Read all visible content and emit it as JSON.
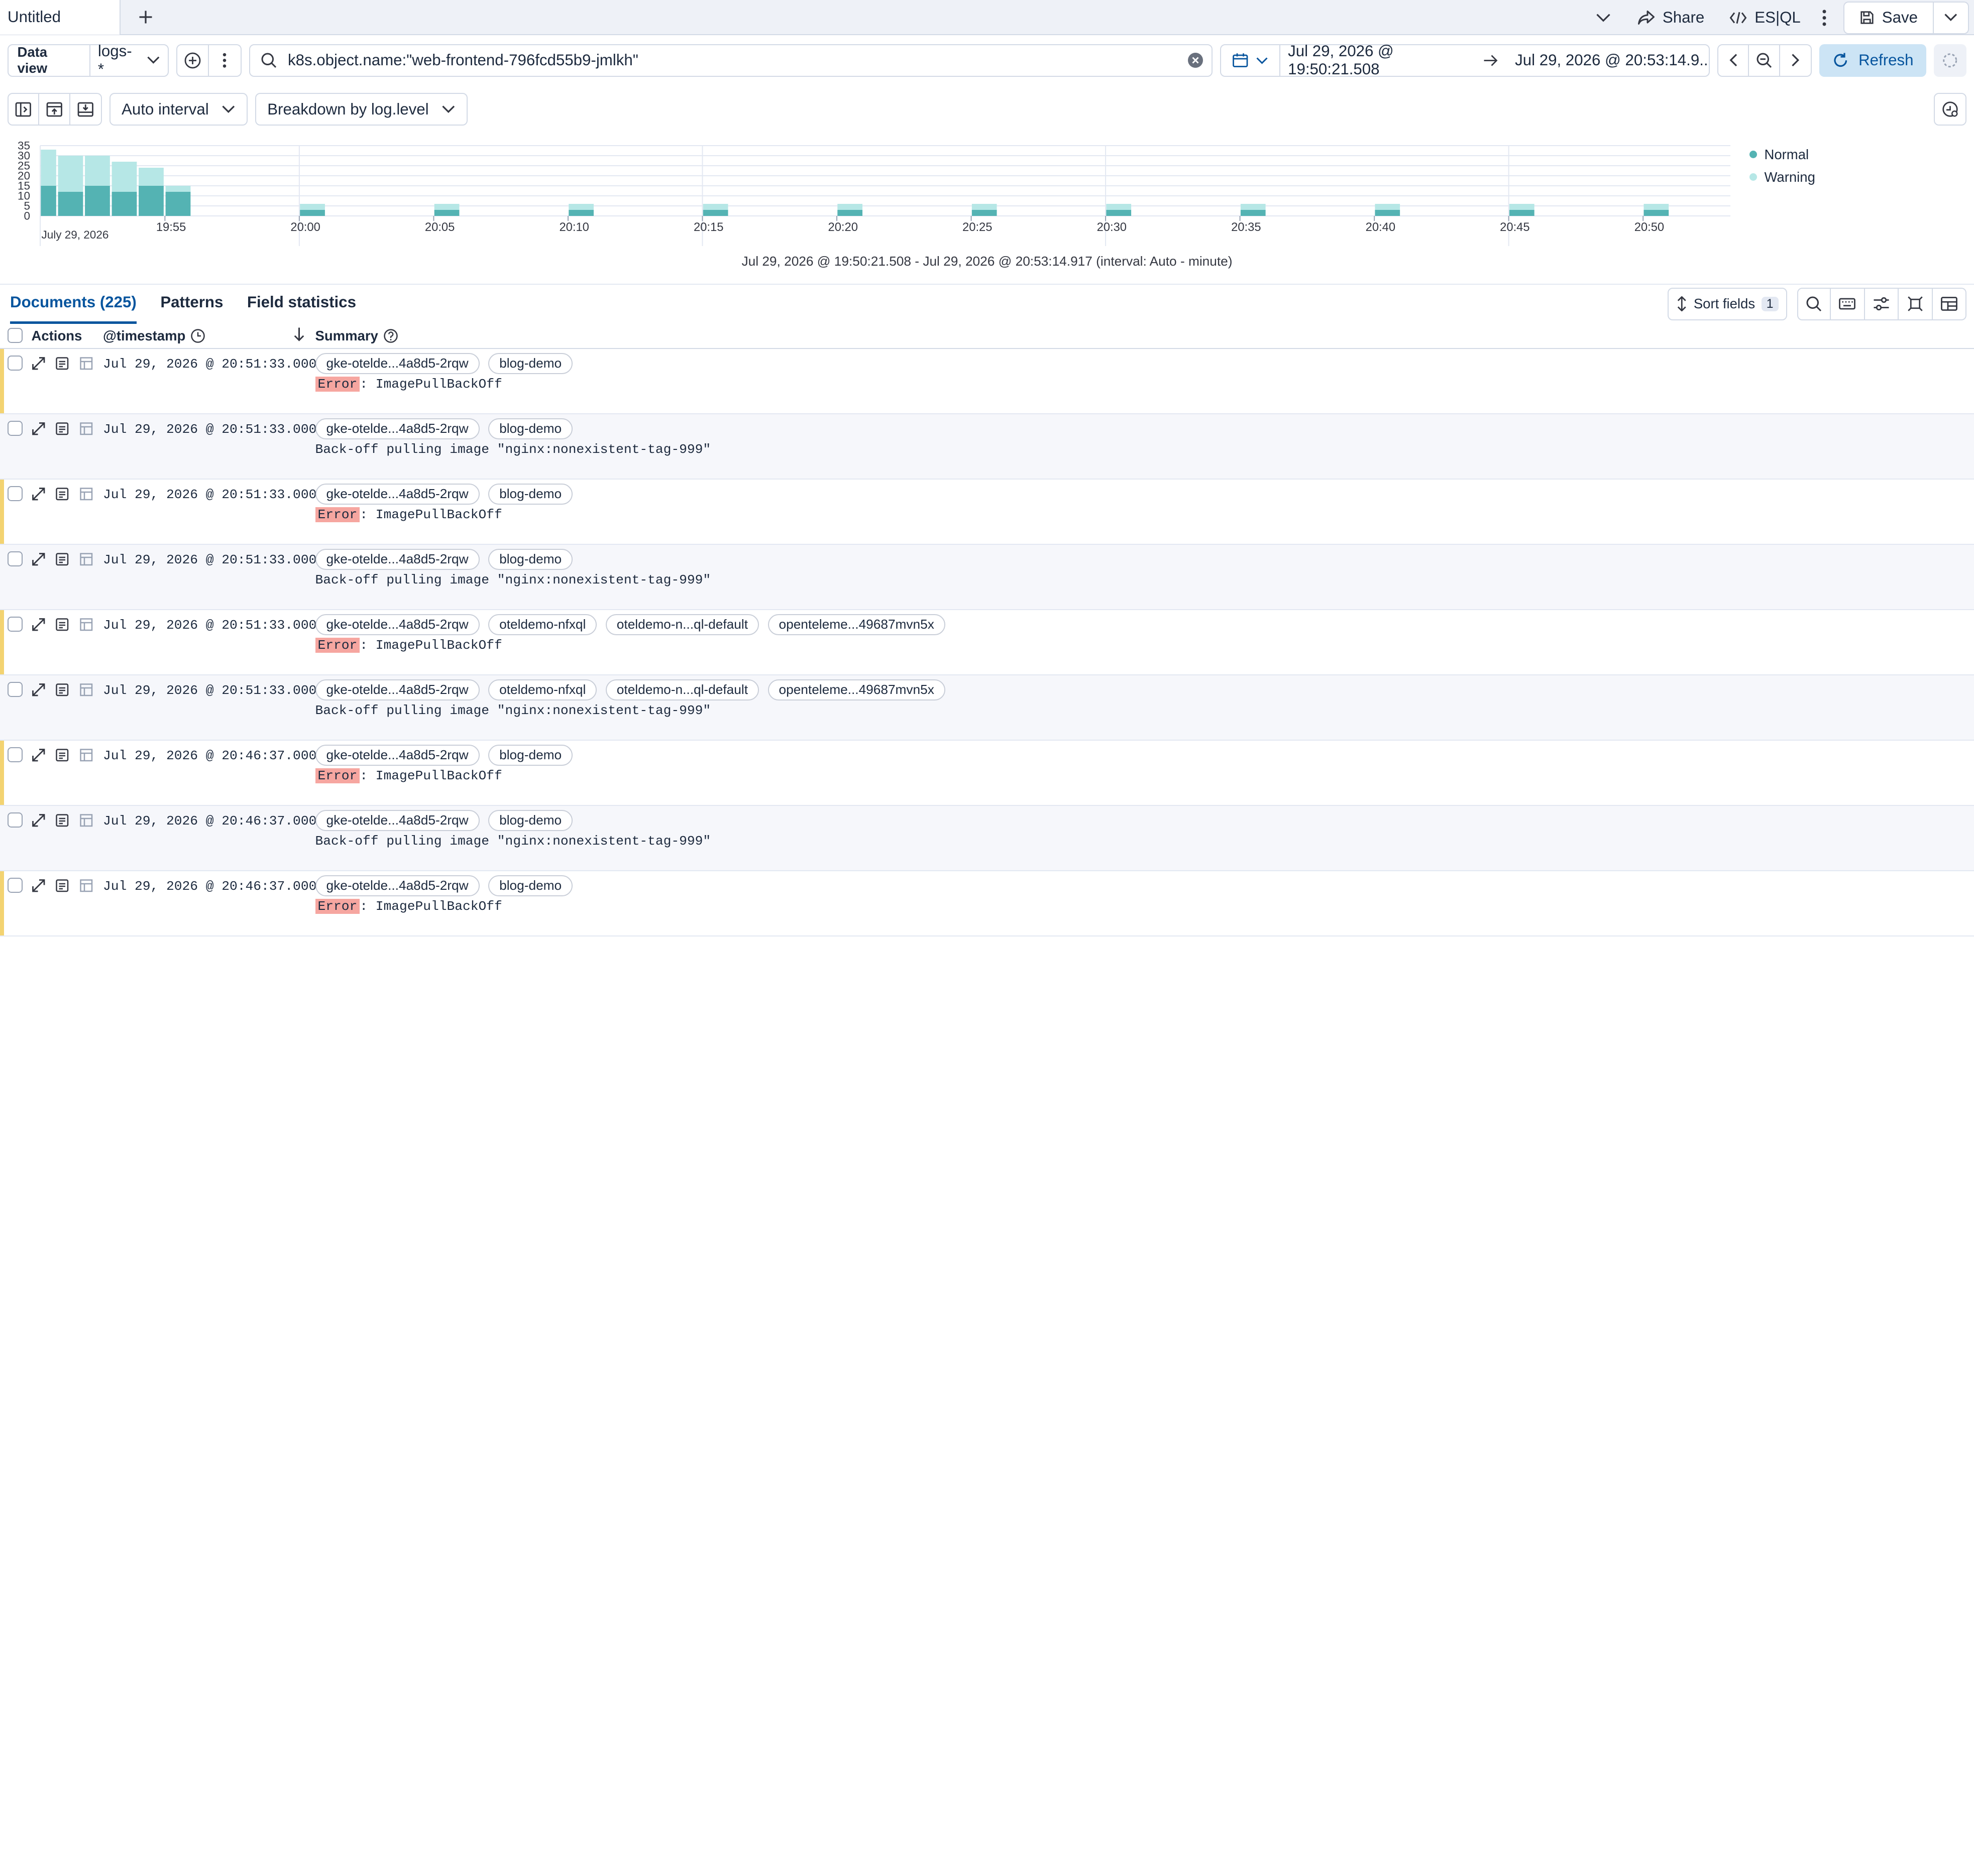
{
  "tabs": {
    "active_label": "Untitled"
  },
  "topbar": {
    "share_label": "Share",
    "esql_label": "ES|QL",
    "save_label": "Save"
  },
  "query": {
    "dataview_label": "Data view",
    "dataview_value": "logs-*",
    "search_value": "k8s.object.name:\"web-frontend-796fcd55b9-jmlkh\"",
    "time_start": "Jul 29, 2026 @ 19:50:21.508",
    "time_end": "Jul 29, 2026 @ 20:53:14.9...",
    "refresh_label": "Refresh"
  },
  "chart_toolbar": {
    "interval_label": "Auto interval",
    "breakdown_label": "Breakdown by log.level"
  },
  "chart_data": {
    "type": "bar",
    "stacked": true,
    "y_ticks": [
      35,
      30,
      25,
      20,
      15,
      10,
      5,
      0
    ],
    "ylim": [
      0,
      35
    ],
    "x_date_label": "July 29, 2026",
    "x_ticks": [
      "19:55",
      "20:00",
      "20:05",
      "20:10",
      "20:15",
      "20:20",
      "20:25",
      "20:30",
      "20:35",
      "20:40",
      "20:45",
      "20:50"
    ],
    "grid": true,
    "legend_position": "right",
    "colors": {
      "Normal": "#54b3b3",
      "Warning": "#b6e7e6"
    },
    "series": [
      {
        "name": "Normal",
        "points": [
          {
            "x": "19:51",
            "value": 15
          },
          {
            "x": "19:52",
            "value": 12
          },
          {
            "x": "19:53",
            "value": 15
          },
          {
            "x": "19:54",
            "value": 12
          },
          {
            "x": "19:55",
            "value": 15
          },
          {
            "x": "19:56",
            "value": 12
          },
          {
            "x": "20:01",
            "value": 3
          },
          {
            "x": "20:06",
            "value": 3
          },
          {
            "x": "20:11",
            "value": 3
          },
          {
            "x": "20:16",
            "value": 3
          },
          {
            "x": "20:21",
            "value": 3
          },
          {
            "x": "20:26",
            "value": 3
          },
          {
            "x": "20:31",
            "value": 3
          },
          {
            "x": "20:36",
            "value": 3
          },
          {
            "x": "20:41",
            "value": 3
          },
          {
            "x": "20:46",
            "value": 3
          },
          {
            "x": "20:51",
            "value": 3
          }
        ]
      },
      {
        "name": "Warning",
        "points": [
          {
            "x": "19:51",
            "value": 18
          },
          {
            "x": "19:52",
            "value": 18
          },
          {
            "x": "19:53",
            "value": 15
          },
          {
            "x": "19:54",
            "value": 15
          },
          {
            "x": "19:55",
            "value": 9
          },
          {
            "x": "19:56",
            "value": 3
          },
          {
            "x": "20:01",
            "value": 3
          },
          {
            "x": "20:06",
            "value": 3
          },
          {
            "x": "20:11",
            "value": 3
          },
          {
            "x": "20:16",
            "value": 3
          },
          {
            "x": "20:21",
            "value": 3
          },
          {
            "x": "20:26",
            "value": 3
          },
          {
            "x": "20:31",
            "value": 3
          },
          {
            "x": "20:36",
            "value": 3
          },
          {
            "x": "20:41",
            "value": 3
          },
          {
            "x": "20:46",
            "value": 3
          },
          {
            "x": "20:51",
            "value": 3
          }
        ]
      }
    ],
    "range_label": "Jul 29, 2026 @ 19:50:21.508 - Jul 29, 2026 @ 20:53:14.917 (interval: Auto - minute)"
  },
  "doc_tabs": [
    {
      "label": "Documents (225)",
      "active": true
    },
    {
      "label": "Patterns",
      "active": false
    },
    {
      "label": "Field statistics",
      "active": false
    }
  ],
  "sort_fields": {
    "label": "Sort fields",
    "count": "1"
  },
  "grid": {
    "columns": {
      "actions": "Actions",
      "timestamp": "@timestamp",
      "summary": "Summary"
    },
    "rows": [
      {
        "timestamp": "Jul 29, 2026 @ 20:51:33.000",
        "badges": [
          "gke-otelde...4a8d5-2rqw",
          "blog-demo"
        ],
        "level": "Error",
        "message": ": ImagePullBackOff",
        "warn": true
      },
      {
        "timestamp": "Jul 29, 2026 @ 20:51:33.000",
        "badges": [
          "gke-otelde...4a8d5-2rqw",
          "blog-demo"
        ],
        "level": "",
        "message": "Back-off pulling image \"nginx:nonexistent-tag-999\"",
        "warn": false
      },
      {
        "timestamp": "Jul 29, 2026 @ 20:51:33.000",
        "badges": [
          "gke-otelde...4a8d5-2rqw",
          "blog-demo"
        ],
        "level": "Error",
        "message": ": ImagePullBackOff",
        "warn": true
      },
      {
        "timestamp": "Jul 29, 2026 @ 20:51:33.000",
        "badges": [
          "gke-otelde...4a8d5-2rqw",
          "blog-demo"
        ],
        "level": "",
        "message": "Back-off pulling image \"nginx:nonexistent-tag-999\"",
        "warn": false
      },
      {
        "timestamp": "Jul 29, 2026 @ 20:51:33.000",
        "badges": [
          "gke-otelde...4a8d5-2rqw",
          "oteldemo-nfxql",
          "oteldemo-n...ql-default",
          "openteleme...49687mvn5x"
        ],
        "level": "Error",
        "message": ": ImagePullBackOff",
        "warn": true
      },
      {
        "timestamp": "Jul 29, 2026 @ 20:51:33.000",
        "badges": [
          "gke-otelde...4a8d5-2rqw",
          "oteldemo-nfxql",
          "oteldemo-n...ql-default",
          "openteleme...49687mvn5x"
        ],
        "level": "",
        "message": "Back-off pulling image \"nginx:nonexistent-tag-999\"",
        "warn": false
      },
      {
        "timestamp": "Jul 29, 2026 @ 20:46:37.000",
        "badges": [
          "gke-otelde...4a8d5-2rqw",
          "blog-demo"
        ],
        "level": "Error",
        "message": ": ImagePullBackOff",
        "warn": true
      },
      {
        "timestamp": "Jul 29, 2026 @ 20:46:37.000",
        "badges": [
          "gke-otelde...4a8d5-2rqw",
          "blog-demo"
        ],
        "level": "",
        "message": "Back-off pulling image \"nginx:nonexistent-tag-999\"",
        "warn": false
      },
      {
        "timestamp": "Jul 29, 2026 @ 20:46:37.000",
        "badges": [
          "gke-otelde...4a8d5-2rqw",
          "blog-demo"
        ],
        "level": "Error",
        "message": ": ImagePullBackOff",
        "warn": true
      }
    ]
  },
  "colors": {
    "accent": "#07559e",
    "refresh_bg": "#cce4f5",
    "error_bg": "#f6a6a0",
    "warn_bar": "#f3d371"
  }
}
